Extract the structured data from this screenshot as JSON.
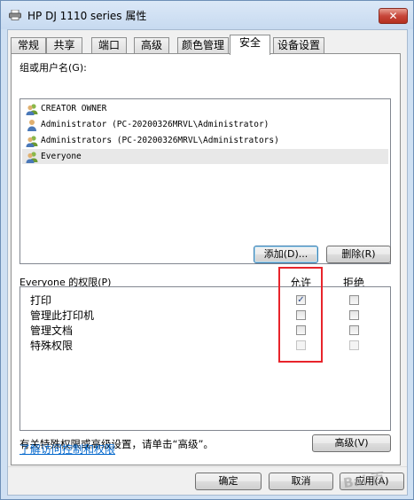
{
  "window": {
    "title": "HP DJ 1110 series 属性",
    "close_label": "✕"
  },
  "tabs": [
    {
      "label": "常规"
    },
    {
      "label": "共享"
    },
    {
      "label": "端口"
    },
    {
      "label": "高级"
    },
    {
      "label": "颜色管理"
    },
    {
      "label": "安全"
    },
    {
      "label": "设备设置"
    }
  ],
  "active_tab": "安全",
  "groups": {
    "label": "组或用户名(G):",
    "items": [
      {
        "name": "CREATOR OWNER",
        "icon": "users-icon",
        "selected": false
      },
      {
        "name": "Administrator (PC-20200326MRVL\\Administrator)",
        "icon": "user-icon",
        "selected": false
      },
      {
        "name": "Administrators (PC-20200326MRVL\\Administrators)",
        "icon": "users-icon",
        "selected": false
      },
      {
        "name": "Everyone",
        "icon": "users-icon",
        "selected": true
      }
    ]
  },
  "buttons": {
    "add": "添加(D)...",
    "remove": "删除(R)",
    "advanced": "高级(V)",
    "ok": "确定",
    "cancel": "取消",
    "apply": "应用(A)"
  },
  "permissions": {
    "label": "Everyone 的权限(P)",
    "allow_header": "允许",
    "deny_header": "拒绝",
    "rows": [
      {
        "name": "打印",
        "allow": true,
        "deny": false,
        "disabled": false
      },
      {
        "name": "管理此打印机",
        "allow": false,
        "deny": false,
        "disabled": false
      },
      {
        "name": "管理文档",
        "allow": false,
        "deny": false,
        "disabled": false
      },
      {
        "name": "特殊权限",
        "allow": false,
        "deny": false,
        "disabled": true
      }
    ]
  },
  "advanced_hint": "有关特殊权限或高级设置，请单击“高级”。",
  "help_link": "了解访问控制和权限",
  "watermark": "Bai 百"
}
